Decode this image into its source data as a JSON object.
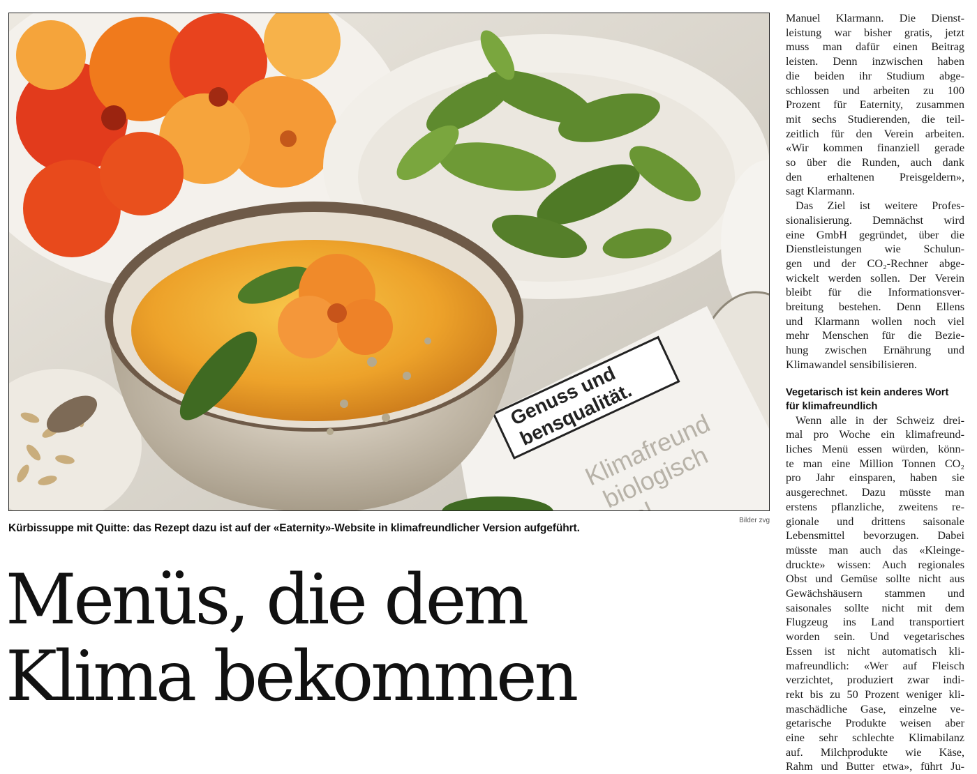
{
  "photo": {
    "card_text": [
      "Genuss und",
      "bensqualität."
    ],
    "card_text_2": [
      "Klimafreund",
      "biologisch",
      "kal."
    ]
  },
  "credit": "Bilder zvg",
  "caption": "Kürbissuppe mit Quitte: das Rezept dazu ist auf der «Eaternity»-Website in klimafreundlicher Version aufgeführt.",
  "headline": {
    "line1": "Menüs, die dem",
    "line2": "Klima bekommen"
  },
  "column": {
    "para1": [
      "Manuel Klarmann. Die Dienst-",
      "leistung war bisher gratis, jetzt",
      "muss man dafür einen Beitrag",
      "leisten. Denn inzwischen haben",
      "die beiden ihr Studium abge-",
      "schlossen und arbeiten zu 100",
      "Prozent für Eaternity, zusammen",
      "mit sechs Studierenden, die teil-",
      "zeitlich für den Verein arbeiten.",
      "«Wir kommen finanziell gerade",
      "so über die Runden, auch dank",
      "den erhaltenen Preisgeldern»,",
      "sagt Klarmann."
    ],
    "para2": [
      "Das Ziel ist weitere Profes-",
      "sionalisierung. Demnächst wird",
      "eine GmbH gegründet, über die",
      "Dienstleistungen wie Schulun-",
      "gen und der CO₂-Rechner abge-",
      "wickelt werden sollen. Der Verein",
      "bleibt für die Informationsver-",
      "breitung bestehen. Denn Ellens",
      "und Klarmann wollen noch viel",
      "mehr Menschen für die Bezie-",
      "hung zwischen Ernährung und",
      "Klimawandel sensibilisieren."
    ],
    "subhead": [
      "Vegetarisch ist kein anderes Wort",
      "für klimafreundlich"
    ],
    "para3": [
      "Wenn alle in der Schweiz drei-",
      "mal pro Woche ein klimafreund-",
      "liches Menü essen würden, könn-",
      "te man eine Million Tonnen CO₂",
      "pro Jahr einsparen, haben sie",
      "ausgerechnet. Dazu müsste man",
      "erstens pflanzliche, zweitens re-",
      "gionale und drittens saisonale",
      "Lebensmittel bevorzugen. Dabei",
      "müsste man auch das «Kleinge-",
      "druckte» wissen: Auch regionales",
      "Obst und Gemüse sollte nicht aus",
      "Gewächshäusern stammen und",
      "saisonales sollte nicht mit dem",
      "Flugzeug ins Land transportiert",
      "worden sein. Und vegetarisches",
      "Essen ist nicht automatisch kli-",
      "mafreundlich: «Wer auf Fleisch",
      "verzichtet, produziert zwar indi-",
      "rekt bis zu 50 Prozent weniger kli-",
      "maschädliche Gase, einzelne ve-",
      "getarische Produkte weisen aber",
      "eine sehr schlechte Klimabilanz",
      "auf. Milchprodukte wie Käse,",
      "Rahm und Butter etwa», führt Ju-"
    ]
  }
}
